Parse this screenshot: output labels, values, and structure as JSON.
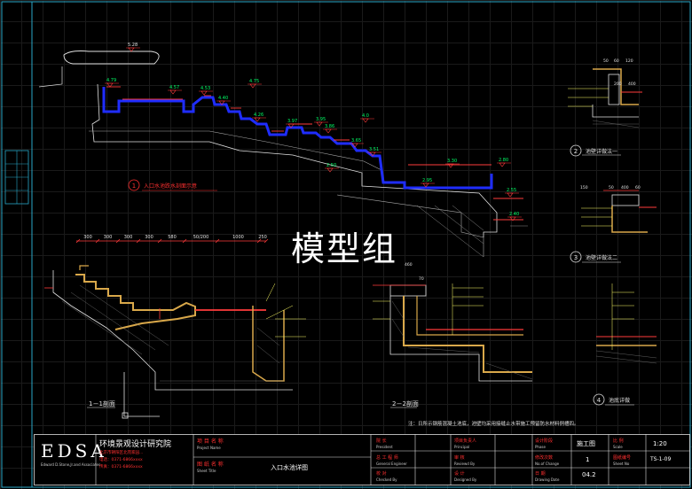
{
  "watermark": "模型组",
  "sections": {
    "s1": {
      "num": "1",
      "label": "入口水池跌水剖面示意"
    },
    "s2": {
      "num": "2",
      "label": "池壁详做法一"
    },
    "s3": {
      "num": "3",
      "label": "池壁详做法二"
    },
    "s4": {
      "num": "4",
      "label": "池底详做"
    },
    "cut11": "1－1剖面",
    "cut22": "2－2剖面",
    "note": "注：日所示钢筋混凝土池底，池壁均采用接缝止水带施工预留防水材料例槽四。"
  },
  "elevations": [
    "5.28",
    "4.79",
    "4.57",
    "4.53",
    "4.40",
    "4.75",
    "4.26",
    "3.97",
    "3.95",
    "3.86",
    "4.0",
    "3.65",
    "3.51",
    "2.50",
    "3.30",
    "2.95",
    "2.55",
    "2.40",
    "2.80"
  ],
  "dims": [
    "300",
    "300",
    "300",
    "300",
    "580",
    "50/200",
    "1000",
    "250"
  ],
  "dims_small": [
    "50",
    "60",
    "120",
    "200",
    "400",
    "150",
    "50",
    "400",
    "60",
    "460",
    "70"
  ],
  "title_block": {
    "logo": "EDSA",
    "logo_sub": "Edward D.Stone,Jr.and Associates",
    "company": "环境景观设计研究院",
    "company_lines": [
      "北京市朝阳区北苑家园...",
      "电话：0371-6866xxxx",
      "传真：0371-6866xxxx"
    ],
    "project_label": "项 目 名 称",
    "project_en": "Project  Name",
    "sheet_label": "图 纸 名 称",
    "sheet_en": "Sheet  Title",
    "sheet_title": "入口水池详图",
    "president_cn": "院    长",
    "president_en": "President",
    "engineer_cn": "总 工 程 师",
    "engineer_en": "General Engineer",
    "checked_cn": "校    对",
    "checked_en": "Checked  By",
    "principal_cn": "项目负责人",
    "principal_en": "Principal",
    "reviewed_cn": "审    核",
    "reviewed_en": "Reviewd By",
    "designed_cn": "设    计",
    "designed_en": "Designed By",
    "phase_cn": "设计阶段",
    "phase_en": "Phase",
    "phase_value": "施工图",
    "change_cn": "修改次数",
    "change_en": "No.of Change",
    "change_value": "1",
    "date_cn": "日    期",
    "date_en": "Drawing Date",
    "date_value": "04.2",
    "scale_cn": "比    例",
    "scale_en": "Scale",
    "scale_value": "1:20",
    "sheetno_cn": "图纸编号",
    "sheetno_en": "Sheet No",
    "sheetno_value": "TS-1-09"
  },
  "colors": {
    "water": "#1f2dff",
    "line": "#e0e0e0",
    "dim": "#ff3b3b",
    "elev": "#00ff66",
    "leader": "#ffff66",
    "frame": "#2aa8c8",
    "titlered": "#ff3030"
  }
}
